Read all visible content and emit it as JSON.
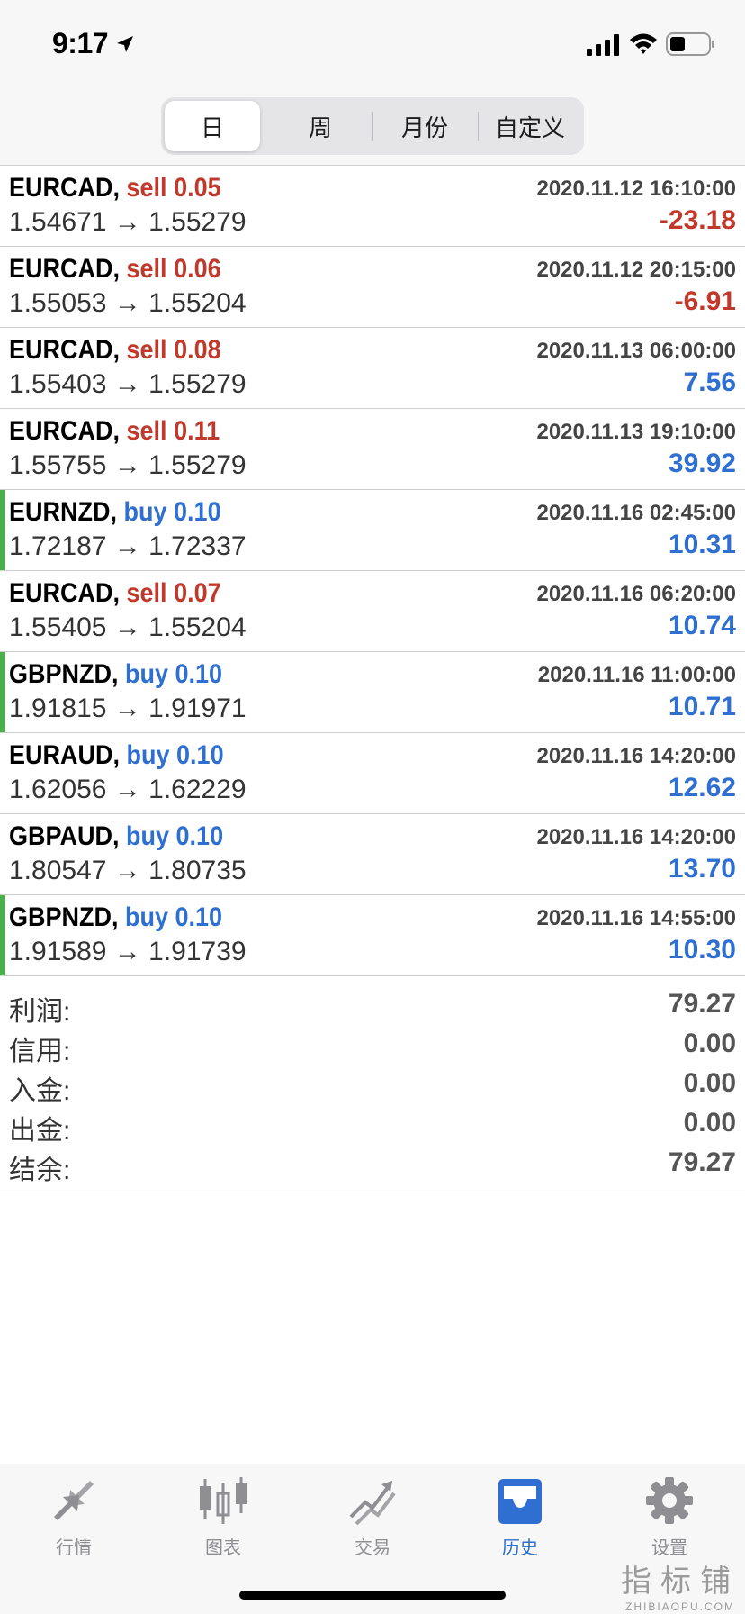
{
  "status": {
    "time": "9:17"
  },
  "segment": {
    "tabs": [
      "日",
      "周",
      "月份",
      "自定义"
    ],
    "active": 0
  },
  "trades": [
    {
      "symbol": "EURCAD,",
      "side": "sell",
      "lots": "0.05",
      "datetime": "2020.11.12 16:10:00",
      "open": "1.54671",
      "close": "1.55279",
      "profit": "-23.18",
      "profit_sign": "neg",
      "bar": false
    },
    {
      "symbol": "EURCAD,",
      "side": "sell",
      "lots": "0.06",
      "datetime": "2020.11.12 20:15:00",
      "open": "1.55053",
      "close": "1.55204",
      "profit": "-6.91",
      "profit_sign": "neg",
      "bar": false
    },
    {
      "symbol": "EURCAD,",
      "side": "sell",
      "lots": "0.08",
      "datetime": "2020.11.13 06:00:00",
      "open": "1.55403",
      "close": "1.55279",
      "profit": "7.56",
      "profit_sign": "pos",
      "bar": false
    },
    {
      "symbol": "EURCAD,",
      "side": "sell",
      "lots": "0.11",
      "datetime": "2020.11.13 19:10:00",
      "open": "1.55755",
      "close": "1.55279",
      "profit": "39.92",
      "profit_sign": "pos",
      "bar": false
    },
    {
      "symbol": "EURNZD,",
      "side": "buy",
      "lots": "0.10",
      "datetime": "2020.11.16 02:45:00",
      "open": "1.72187",
      "close": "1.72337",
      "profit": "10.31",
      "profit_sign": "pos",
      "bar": true
    },
    {
      "symbol": "EURCAD,",
      "side": "sell",
      "lots": "0.07",
      "datetime": "2020.11.16 06:20:00",
      "open": "1.55405",
      "close": "1.55204",
      "profit": "10.74",
      "profit_sign": "pos",
      "bar": false
    },
    {
      "symbol": "GBPNZD,",
      "side": "buy",
      "lots": "0.10",
      "datetime": "2020.11.16 11:00:00",
      "open": "1.91815",
      "close": "1.91971",
      "profit": "10.71",
      "profit_sign": "pos",
      "bar": true
    },
    {
      "symbol": "EURAUD,",
      "side": "buy",
      "lots": "0.10",
      "datetime": "2020.11.16 14:20:00",
      "open": "1.62056",
      "close": "1.62229",
      "profit": "12.62",
      "profit_sign": "pos",
      "bar": false
    },
    {
      "symbol": "GBPAUD,",
      "side": "buy",
      "lots": "0.10",
      "datetime": "2020.11.16 14:20:00",
      "open": "1.80547",
      "close": "1.80735",
      "profit": "13.70",
      "profit_sign": "pos",
      "bar": false
    },
    {
      "symbol": "GBPNZD,",
      "side": "buy",
      "lots": "0.10",
      "datetime": "2020.11.16 14:55:00",
      "open": "1.91589",
      "close": "1.91739",
      "profit": "10.30",
      "profit_sign": "pos",
      "bar": true
    }
  ],
  "arrow": "→",
  "summary": [
    {
      "label": "利润:",
      "value": "79.27"
    },
    {
      "label": "信用:",
      "value": "0.00"
    },
    {
      "label": "入金:",
      "value": "0.00"
    },
    {
      "label": "出金:",
      "value": "0.00"
    },
    {
      "label": "结余:",
      "value": "79.27"
    }
  ],
  "tabbar": [
    {
      "label": "行情",
      "icon": "quotes-icon"
    },
    {
      "label": "图表",
      "icon": "chart-icon"
    },
    {
      "label": "交易",
      "icon": "trade-icon"
    },
    {
      "label": "历史",
      "icon": "history-icon"
    },
    {
      "label": "设置",
      "icon": "settings-icon"
    }
  ],
  "active_tab": 3,
  "watermark": {
    "cn": "指标铺",
    "en": "ZHIBIAOPU.COM"
  },
  "colors": {
    "sell": "#c0392b",
    "buy": "#2f6fd1",
    "negative": "#c0392b",
    "positive": "#2f6fd1",
    "active_tab": "#2f6fd1",
    "inactive_tab": "#8e8e93",
    "buy_marker": "#4cae4c"
  }
}
